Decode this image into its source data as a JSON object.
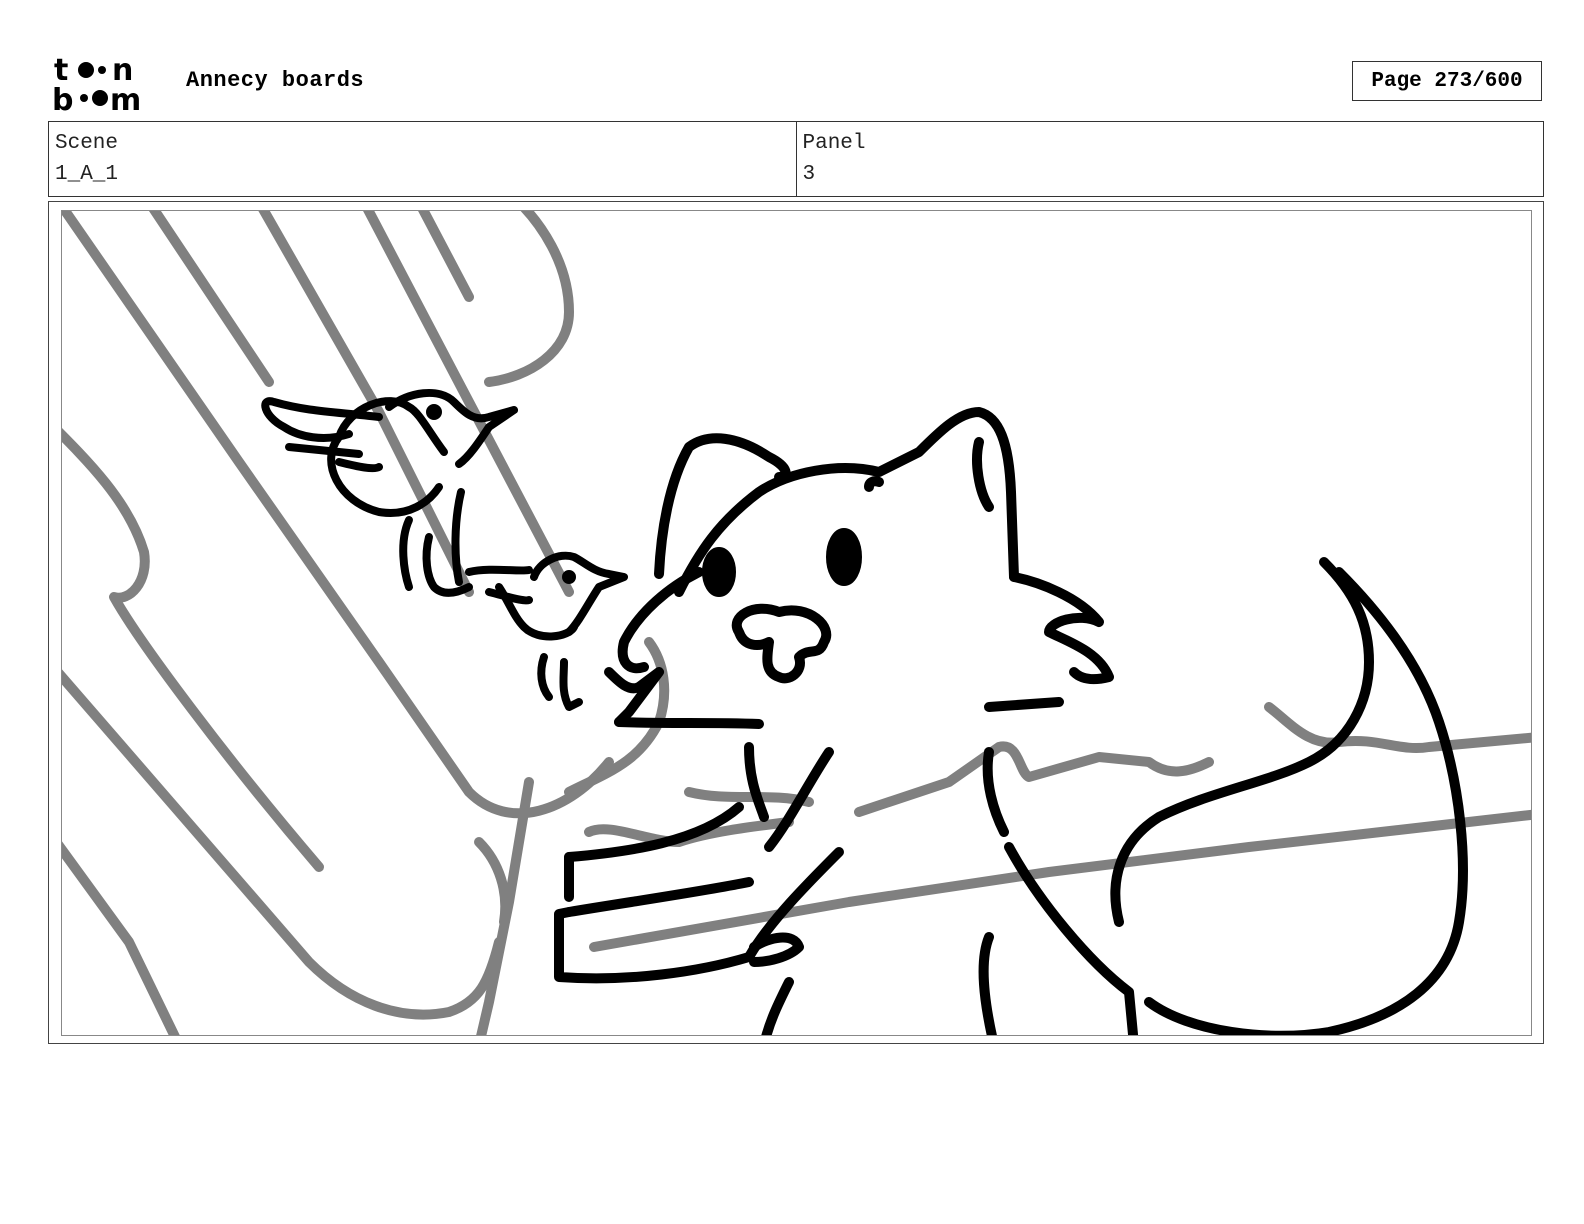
{
  "header": {
    "logo_text_top": "toon",
    "logo_text_bottom": "boom",
    "project_title": "Annecy boards",
    "page_label": "Page 273/600"
  },
  "info": {
    "scene_label": "Scene",
    "scene_value": "1_A_1",
    "panel_label": "Panel",
    "panel_value": "3"
  },
  "artwork": {
    "description_icons": [
      "tree-trunk-sketch",
      "bird-sketch",
      "cat-sketch",
      "branch-sketch"
    ],
    "colors": {
      "ink": "#000000",
      "rough": "#808080",
      "frame": "#444444"
    }
  }
}
